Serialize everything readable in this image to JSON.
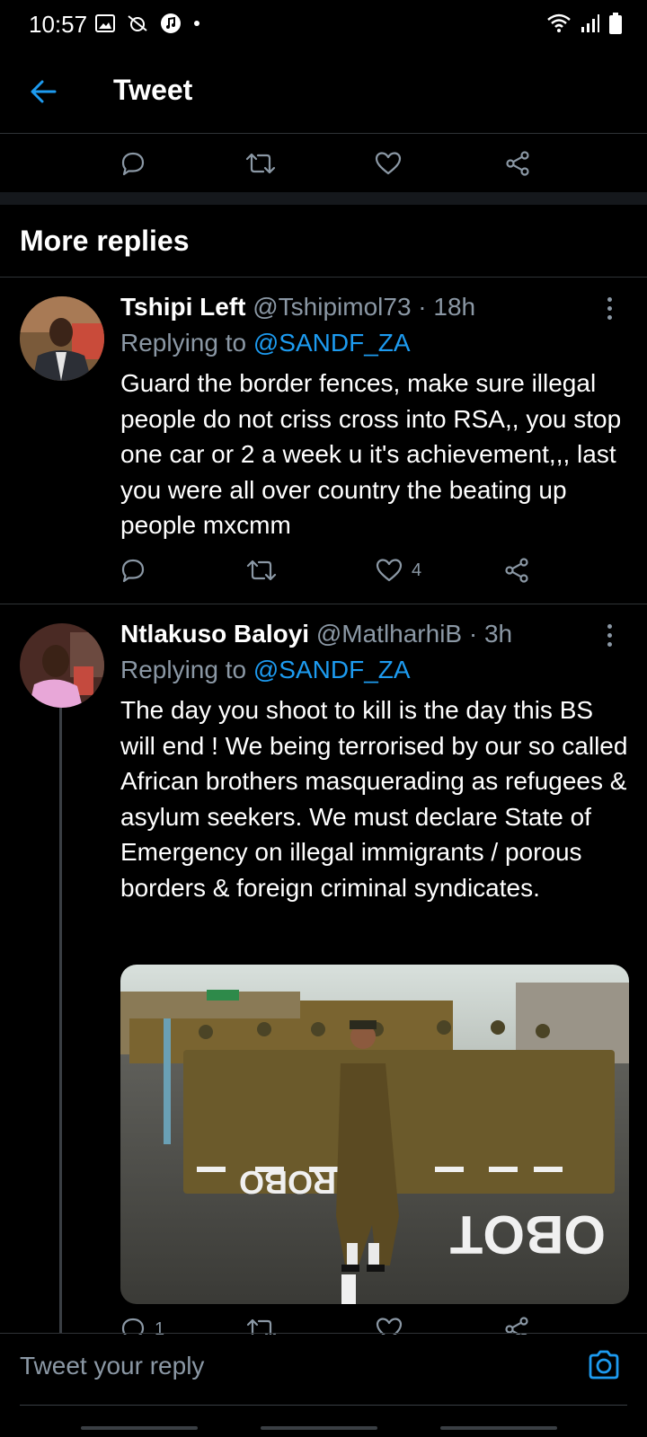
{
  "status_bar": {
    "time": "10:57"
  },
  "header": {
    "title": "Tweet"
  },
  "section": {
    "title": "More replies"
  },
  "colors": {
    "accent": "#1d9bf0",
    "secondary_text": "#8b98a5",
    "background": "#000000"
  },
  "icons": {
    "back": "arrow-left-icon",
    "reply": "reply-icon",
    "retweet": "retweet-icon",
    "like": "heart-icon",
    "share": "share-icon",
    "more": "more-vertical-icon",
    "camera": "camera-icon"
  },
  "replies": [
    {
      "name": "Tshipi Left",
      "meta": "@Tshipimol73 · 18h",
      "replying_prefix": "Replying to",
      "replying_handle": "@SANDF_ZA",
      "text": "Guard the border fences, make sure illegal people do not criss cross into RSA,, you stop one car or 2 a week u it's achievement,,, last you were all over country the beating up people mxcmm",
      "like_count": "4"
    },
    {
      "name": "Ntlakuso Baloyi",
      "meta": "@MatlharhiB · 3h",
      "replying_prefix": "Replying to",
      "replying_handle": "@SANDF_ZA",
      "text": "The day you shoot to kill is the day this BS will end ! We being terrorised by our so called African brothers masquerading as refugees & asylum seekers. We must declare State of Emergency on illegal immigrants / porous borders & foreign criminal syndicates.",
      "reply_count": "1",
      "image_road_text_far": "ROBO",
      "image_road_text_near": "OBOT"
    }
  ],
  "composer": {
    "placeholder": "Tweet your reply"
  }
}
